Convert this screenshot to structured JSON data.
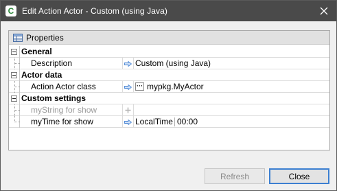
{
  "window": {
    "title": "Edit Action Actor - Custom (using Java)",
    "app_icon": "app-logo-icon",
    "close_icon": "close-icon"
  },
  "panel": {
    "header_label": "Properties",
    "header_icon": "properties-table-icon"
  },
  "categories": [
    {
      "label": "General",
      "properties": [
        {
          "name": "Description",
          "value": "Custom (using Java)",
          "arrow_icon": "arrow-right-icon",
          "disabled": false
        }
      ]
    },
    {
      "label": "Actor data",
      "properties": [
        {
          "name": "Action Actor class",
          "value": "mypkg.MyActor",
          "arrow_icon": "arrow-right-icon",
          "browse_label": "···",
          "disabled": false
        }
      ]
    },
    {
      "label": "Custom settings",
      "properties": [
        {
          "name": "myString for show",
          "value": "",
          "arrow_icon": "plus-icon",
          "disabled": true
        },
        {
          "name": "myTime for show",
          "type_label": "LocalTime",
          "value": "00:00",
          "arrow_icon": "arrow-right-icon",
          "disabled": false
        }
      ]
    }
  ],
  "buttons": {
    "refresh": "Refresh",
    "close": "Close"
  },
  "colors": {
    "titlebar": "#4a4a4a",
    "accent": "#3c7fd1",
    "arrow": "#4a86d4"
  }
}
